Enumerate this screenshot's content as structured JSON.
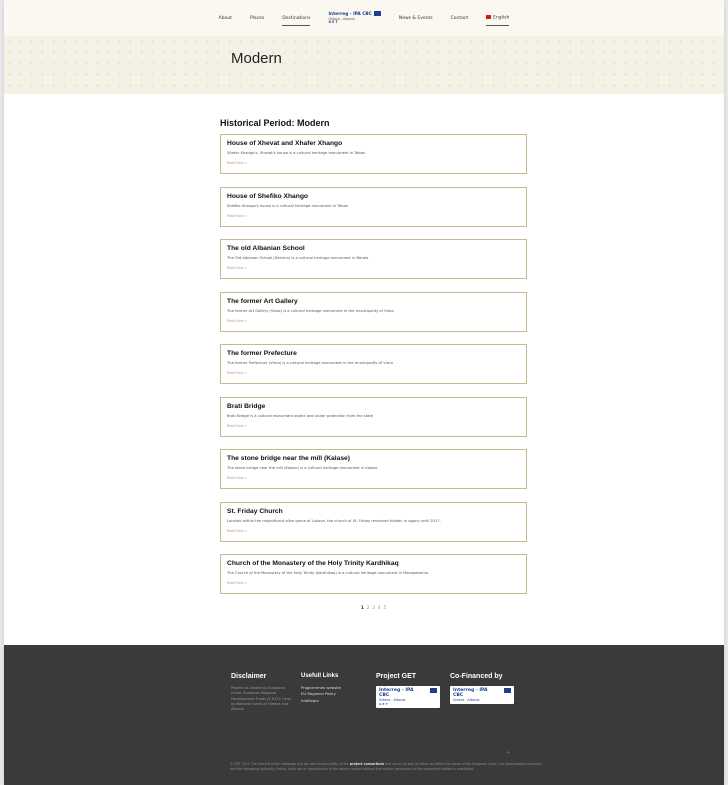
{
  "nav": {
    "items": [
      "About",
      "Places",
      "Destinations"
    ],
    "items_right": [
      "News & Events",
      "Contact"
    ],
    "logo": {
      "line1": "Interreg - IPA CBC",
      "line2": "Greece - Albania",
      "line3": "G E T"
    },
    "language": "English"
  },
  "hero": {
    "title": "Modern"
  },
  "main": {
    "section_title": "Historical Period: Modern",
    "read_more": "Read More »",
    "cards": [
      {
        "title": "House of Xhevat and Xhafer Xhango",
        "desc": "Xhafer Xhango's, Xhevat's house is a cultural heritage monument in Tabak"
      },
      {
        "title": "House of Shefiko Xhango",
        "desc": "Shefiko Xhango's house is a cultural heritage monument in Tabak"
      },
      {
        "title": "The old Albanian School",
        "desc": "The Old Albanian School (Dervica) is a cultural heritage monument in Beraia"
      },
      {
        "title": "The former Art Gallery",
        "desc": "The former Art Gallery (Vlora) is a cultural heritage monument in the municipality of Vlora"
      },
      {
        "title": "The former Prefecture",
        "desc": "The former Prefecture (Vlora) is a cultural heritage monument in the municipality of Vlora"
      },
      {
        "title": "Brati Bridge",
        "desc": "Brati Bridge is a cultural monument object and under protection from the state"
      },
      {
        "title": "The stone bridge near the mill (Kalase)",
        "desc": "The stone bridge near the mill (Kalase) is a cultural heritage monument in Kalase"
      },
      {
        "title": "St. Friday Church",
        "desc": "Located within the magnificent olive grove of Lukova, the church of St. Friday remained hidden in agony until 2017."
      },
      {
        "title": "Church of the Monastery of the Holy Trinity Kardhikaq",
        "desc": "The Church of the Monastery of the Holy Trinity (Kardhikaq) is a cultural heritage monument in Mesopotamia"
      }
    ]
  },
  "pagination": {
    "pages": [
      "1",
      "2",
      "3",
      "4",
      "5"
    ],
    "current": "1"
  },
  "footer": {
    "disclaimer": {
      "title": "Disclaimer",
      "text": "Project co-funded by European Union, European Regional Development Funds (E.R.D.F.) and by National Funds of Greece and Albania"
    },
    "links": {
      "title": "Usefull Links",
      "items": [
        "Programmes website",
        "EU Regional Policy",
        "InfoRegio"
      ]
    },
    "project": {
      "title": "Project GET",
      "logo": {
        "line1": "Interreg - IPA CBC",
        "line2": "Greece - Albania",
        "line3": "G E T"
      }
    },
    "cofinanced": {
      "title": "Co-Financed by",
      "logo": {
        "line1": "Interreg - IPA CBC",
        "line2": "Greece - Albania"
      }
    },
    "copyright_pre": "© GET 2021 The content of this webpage are the sole responsibility of the",
    "copyright_bold": "project consortium",
    "copyright_post": "and can in no way be taken to reflect the views of the European Union, the participating countries and the Managing Authority. Partial, total use or reproduction of the above content without the written permission of the competent bodies is prohibited.",
    "scroll_icon": "chevron-up-icon"
  },
  "colors": {
    "accent": "#c8b892",
    "footer_bg": "#3a3a3a",
    "logo_blue": "#1d3f8c",
    "hero_bg": "#f6f1e6"
  }
}
